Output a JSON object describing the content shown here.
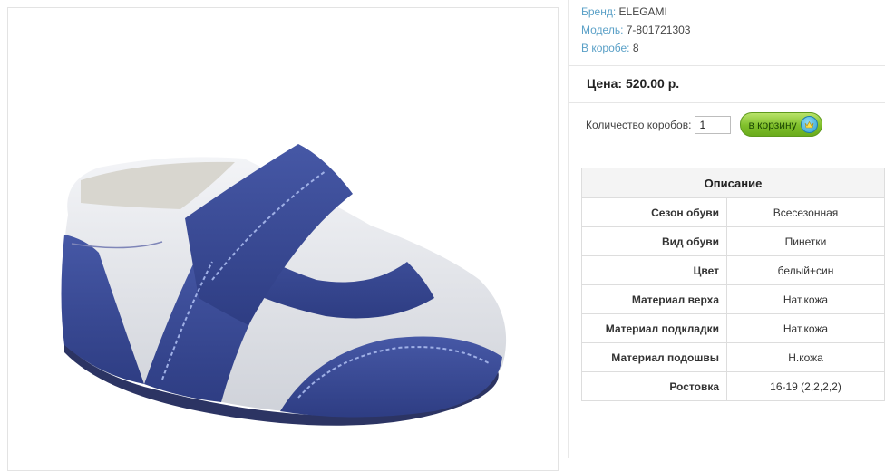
{
  "meta": {
    "brand_label": "Бренд:",
    "brand_value": "ELEGAMI",
    "model_label": "Модель:",
    "model_value": "7-801721303",
    "box_label": "В коробе:",
    "box_value": "8"
  },
  "price": "Цена: 520.00 р.",
  "order": {
    "qty_label": "Количество коробов:",
    "qty_value": "1",
    "cart_label": "в корзину",
    "cart_icon": "crown-icon"
  },
  "description": {
    "title": "Описание",
    "rows": [
      {
        "key": "Сезон обуви",
        "value": "Всесезонная"
      },
      {
        "key": "Вид обуви",
        "value": "Пинетки"
      },
      {
        "key": "Цвет",
        "value": "белый+син"
      },
      {
        "key": "Материал верха",
        "value": "Нат.кожа"
      },
      {
        "key": "Материал подкладки",
        "value": "Нат.кожа"
      },
      {
        "key": "Материал подошвы",
        "value": "Н.кожа"
      },
      {
        "key": "Ростовка",
        "value": "16-19 (2,2,2,2)"
      }
    ]
  },
  "colors": {
    "accent_label": "#5aa0c7",
    "cart_green": "#7fbf2a",
    "shoe_blue": "#3a4d9a",
    "shoe_white": "#e9eaee"
  }
}
